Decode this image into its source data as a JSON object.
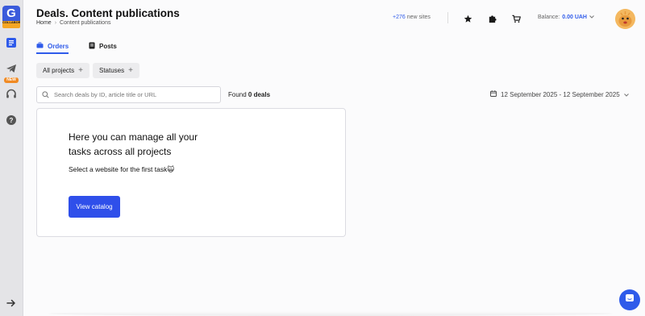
{
  "sidebar": {
    "logo": {
      "letter": "G",
      "text": "COLLABORATOR"
    },
    "items": [
      {
        "icon": "document-list-icon"
      },
      {
        "icon": "telegram-icon",
        "badge": "NEW"
      },
      {
        "icon": "headset-icon"
      },
      {
        "icon": "help-icon"
      }
    ],
    "collapse_icon": "arrow-right-icon"
  },
  "header": {
    "title": "Deals. Content publications",
    "breadcrumb": [
      "Home",
      "Content publications"
    ],
    "new_sites_count": "+276",
    "new_sites_label": "new sites",
    "balance_label": "Balance:",
    "balance_amount": "0.00 UAH",
    "icons": [
      "star-icon",
      "puzzle-icon",
      "cart-icon"
    ]
  },
  "tabs": [
    {
      "label": "Orders",
      "active": true,
      "icon": "briefcase-icon"
    },
    {
      "label": "Posts",
      "active": false,
      "icon": "note-icon"
    }
  ],
  "filters": {
    "chips": [
      "All projects",
      "Statuses"
    ],
    "search_placeholder": "Search deals by ID, article title or URL",
    "found_prefix": "Found",
    "found_count": "0 deals",
    "date_range": "12 September 2025 - 12 September 2025"
  },
  "empty_state": {
    "title": "Here you can manage all your tasks across all projects",
    "subtitle": "Select a website for the first task",
    "emoji": "🙀",
    "button_label": "View catalog"
  },
  "colors": {
    "accent": "#2f5bea",
    "button": "#2f4fea",
    "badge": "#f08a24"
  }
}
